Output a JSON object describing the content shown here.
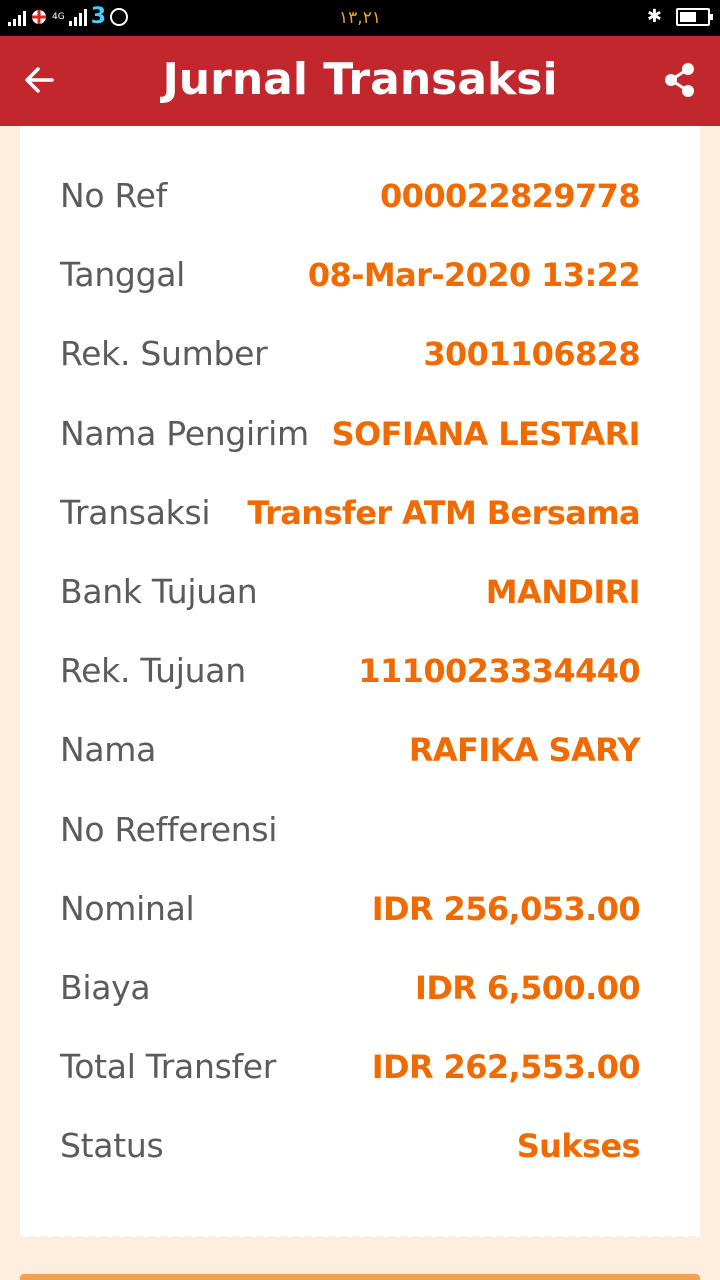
{
  "status_bar": {
    "network": "4G",
    "carrier": "3",
    "time": "١٣,٢١"
  },
  "header": {
    "title": "Jurnal Transaksi",
    "back_icon": "arrow-left-icon",
    "share_icon": "share-icon"
  },
  "colors": {
    "header_bg": "#c1272d",
    "value_color": "#f16a00",
    "label_color": "#5b5b5b",
    "page_bg": "#fdeede"
  },
  "details": [
    {
      "label": "No Ref",
      "value": "000022829778"
    },
    {
      "label": "Tanggal",
      "value": "08-Mar-2020 13:22"
    },
    {
      "label": "Rek. Sumber",
      "value": "3001106828"
    },
    {
      "label": "Nama Pengirim",
      "value": "SOFIANA LESTARI"
    },
    {
      "label": "Transaksi",
      "value": "Transfer ATM Bersama"
    },
    {
      "label": "Bank Tujuan",
      "value": "MANDIRI"
    },
    {
      "label": "Rek. Tujuan",
      "value": "1110023334440"
    },
    {
      "label": "Nama",
      "value": "RAFIKA SARY"
    },
    {
      "label": "No Refferensi",
      "value": ""
    },
    {
      "label": "Nominal",
      "value": "IDR 256,053.00"
    },
    {
      "label": "Biaya",
      "value": "IDR 6,500.00"
    },
    {
      "label": "Total Transfer",
      "value": "IDR 262,553.00"
    },
    {
      "label": "Status",
      "value": "Sukses"
    }
  ]
}
